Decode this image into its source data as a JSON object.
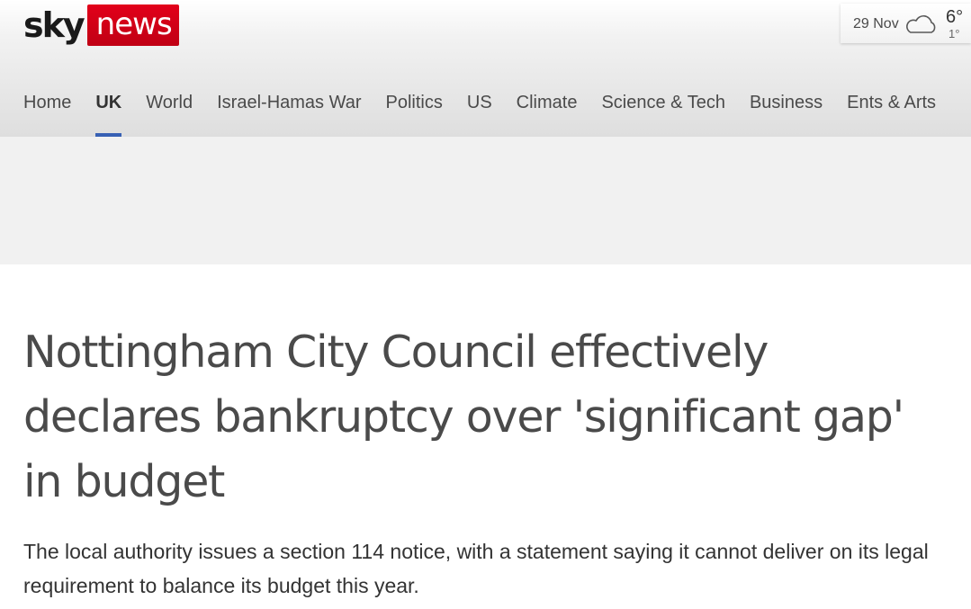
{
  "brand": {
    "logo_sky": "sky",
    "logo_news": "news",
    "accent_red": "#e2001a",
    "nav_active_color": "#3760b4"
  },
  "weather": {
    "date": "29 Nov",
    "icon": "cloud-icon",
    "high": "6°",
    "low": "1°"
  },
  "nav": {
    "items": [
      {
        "label": "Home",
        "active": false
      },
      {
        "label": "UK",
        "active": true
      },
      {
        "label": "World",
        "active": false
      },
      {
        "label": "Israel-Hamas War",
        "active": false
      },
      {
        "label": "Politics",
        "active": false
      },
      {
        "label": "US",
        "active": false
      },
      {
        "label": "Climate",
        "active": false
      },
      {
        "label": "Science & Tech",
        "active": false
      },
      {
        "label": "Business",
        "active": false
      },
      {
        "label": "Ents & Arts",
        "active": false
      }
    ]
  },
  "article": {
    "headline": "Nottingham City Council effectively declares bankruptcy over 'significant gap' in budget",
    "standfirst": "The local authority issues a section 114 notice, with a statement saying it cannot deliver on its legal requirement to balance its budget this year."
  }
}
